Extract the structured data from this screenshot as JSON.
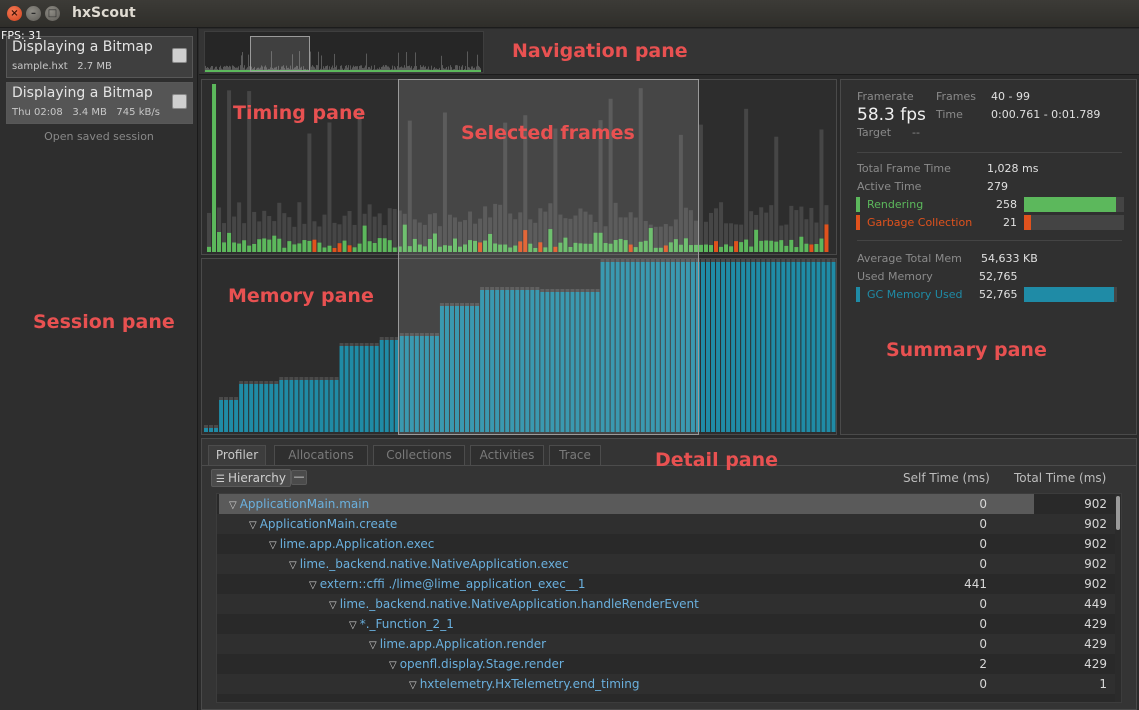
{
  "window": {
    "title": "hxScout",
    "fps_label": "FPS: 31"
  },
  "annotations": {
    "navigation": "Navigation pane",
    "timing": "Timing pane",
    "selected": "Selected frames",
    "memory": "Memory pane",
    "session": "Session pane",
    "summary": "Summary pane",
    "detail": "Detail pane"
  },
  "sessions": [
    {
      "name": "Displaying a Bitmap",
      "meta": "sample.hxt   2.7 MB"
    },
    {
      "name": "Displaying a Bitmap",
      "meta": "Thu 02:08   3.4 MB   745 kB/s"
    }
  ],
  "open_session_label": "Open saved session",
  "summary": {
    "framerate_label": "Framerate",
    "framerate_value": "58.3 fps",
    "target_label": "Target",
    "target_value": "--",
    "frames_label": "Frames",
    "frames_value": "40 - 99",
    "time_label": "Time",
    "time_value": "0:00.761 - 0:01.789",
    "total_frame_time_label": "Total Frame Time",
    "total_frame_time_value": "1,028 ms",
    "active_time_label": "Active Time",
    "active_time_value": "279",
    "rendering_label": "Rendering",
    "rendering_value": "258",
    "rendering_fraction": 0.92,
    "gc_label": "Garbage Collection",
    "gc_value": "21",
    "gc_fraction": 0.07,
    "avg_mem_label": "Average Total Mem",
    "avg_mem_value": "54,633 KB",
    "used_mem_label": "Used Memory",
    "used_mem_value": "52,765",
    "gc_mem_label": "GC Memory Used",
    "gc_mem_value": "52,765",
    "gc_mem_fraction": 0.97,
    "colors": {
      "rendering": "#5cb85c",
      "gc": "#e0521d",
      "memory": "#1f8ba6"
    }
  },
  "detail": {
    "tabs": [
      "Profiler",
      "Allocations",
      "Collections",
      "Activities",
      "Trace"
    ],
    "active_tab": "Profiler",
    "hierarchy_label": "Hierarchy",
    "col_self": "Self Time (ms)",
    "col_total": "Total Time (ms)",
    "rows": [
      {
        "name": "ApplicationMain.main",
        "self": "0",
        "total": "902"
      },
      {
        "name": "ApplicationMain.create",
        "self": "0",
        "total": "902"
      },
      {
        "name": "lime.app.Application.exec",
        "self": "0",
        "total": "902"
      },
      {
        "name": "lime._backend.native.NativeApplication.exec",
        "self": "0",
        "total": "902"
      },
      {
        "name": "extern::cffi ./lime@lime_application_exec__1",
        "self": "441",
        "total": "902"
      },
      {
        "name": "lime._backend.native.NativeApplication.handleRenderEvent",
        "self": "0",
        "total": "449"
      },
      {
        "name": "*._Function_2_1",
        "self": "0",
        "total": "429"
      },
      {
        "name": "lime.app.Application.render",
        "self": "0",
        "total": "429"
      },
      {
        "name": "openfl.display.Stage.render",
        "self": "2",
        "total": "429"
      },
      {
        "name": "hxtelemetry.HxTelemetry.end_timing",
        "self": "0",
        "total": "1"
      }
    ]
  }
}
